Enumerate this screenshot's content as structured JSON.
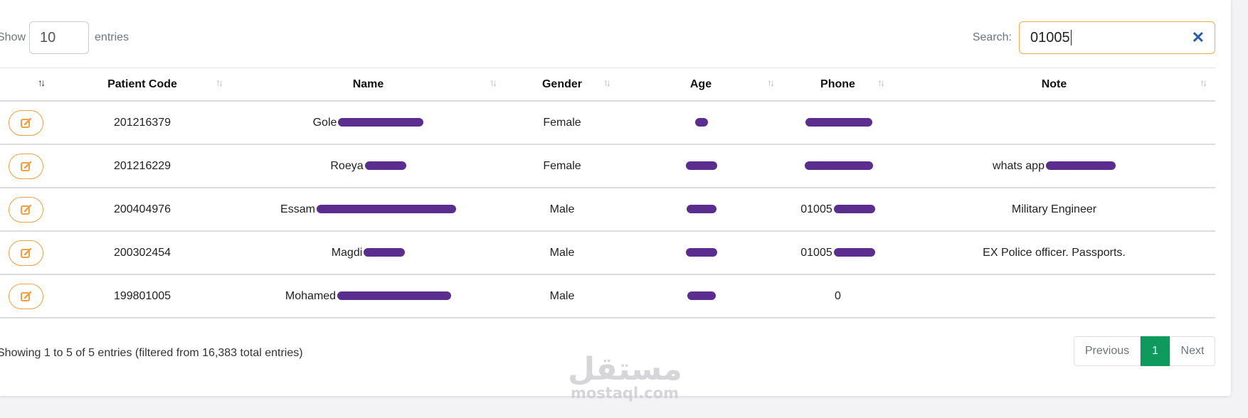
{
  "length_menu": {
    "show_label": "Show",
    "value": "10",
    "entries_label": "entries"
  },
  "search": {
    "label": "Search:",
    "value": "01005"
  },
  "table": {
    "columns": [
      "",
      "Patient Code",
      "Name",
      "Gender",
      "Age",
      "Phone",
      "Note"
    ],
    "rows": [
      {
        "code": "201216379",
        "name": "Gole",
        "gender": "Female",
        "phone": "",
        "note": ""
      },
      {
        "code": "201216229",
        "name": "Roeya",
        "gender": "Female",
        "phone": "",
        "note": "whats app"
      },
      {
        "code": "200404976",
        "name": "Essam",
        "gender": "Male",
        "phone": "01005",
        "note": "Military Engineer"
      },
      {
        "code": "200302454",
        "name": "Magdi",
        "gender": "Male",
        "phone": "01005",
        "note": "EX Police officer. Passports."
      },
      {
        "code": "199801005",
        "name": "Mohamed",
        "gender": "Male",
        "phone": "0",
        "note": ""
      }
    ]
  },
  "info": "Showing 1 to 5 of 5 entries (filtered from 16,383 total entries)",
  "pagination": {
    "previous": "Previous",
    "current": "1",
    "next": "Next"
  },
  "watermark": {
    "arabic": "مستقل",
    "latin": "mostaql.com"
  },
  "colors": {
    "accent_orange": "#f0a040",
    "page_active_green": "#0e9a5c",
    "redaction_purple": "#5b2d8f"
  }
}
